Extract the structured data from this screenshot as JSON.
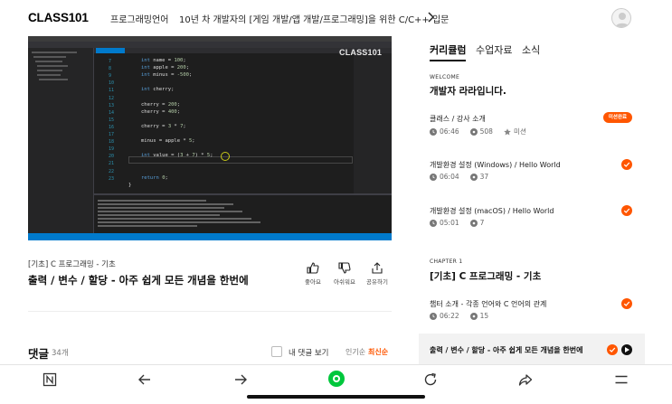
{
  "header": {
    "logo": "CLASS101",
    "breadcrumb_category": "프로그래밍언어",
    "breadcrumb_course": "10년 차 개발자의 [게임 개발/앱 개발/프로그래밍]을 위한 C/C++ 입문"
  },
  "video": {
    "watermark": "CLASS101",
    "line_numbers": [
      "7",
      "8",
      "9",
      "10",
      "11",
      "12",
      "13",
      "14",
      "15",
      "16",
      "17",
      "18",
      "19",
      "20",
      "21",
      "22",
      "23"
    ],
    "code_lines": [
      "int name = 100;",
      "int apple = 200;",
      "int minus = -500;",
      "int cherry;",
      "cherry = 200;",
      "cherry = 400;",
      "cherry = 3 * 7;",
      "minus = apple * 5;",
      "int value = (3 + 7) * 5;",
      "return 0;",
      "}"
    ]
  },
  "lecture": {
    "category": "[기초] C 프로그래밍 - 기초",
    "title": "출력 / 변수 / 할당 - 아주 쉽게 모든 개념을 한번에",
    "actions": {
      "like": "좋아요",
      "dislike": "아쉬워요",
      "share": "공유하기"
    }
  },
  "comments": {
    "title": "댓글",
    "count": "34개",
    "my_comments": "내 댓글 보기",
    "sort_popular": "인기순",
    "sort_latest": "최신순"
  },
  "sidebar": {
    "tabs": [
      "커리큘럼",
      "수업자료",
      "소식"
    ],
    "welcome_label": "WELCOME",
    "welcome_title": "개발자 라라입니다.",
    "items": [
      {
        "title": "클래스 / 강사 소개",
        "duration": "06:46",
        "views": "508",
        "status": "미션",
        "badge": "미션완료"
      },
      {
        "title": "개발환경 설정 (Windows) / Hello World",
        "duration": "06:04",
        "views": "37"
      },
      {
        "title": "개발환경 설정 (macOS) / Hello World",
        "duration": "05:01",
        "views": "7"
      }
    ],
    "chapter_label": "CHAPTER 1",
    "chapter_title": "[기초] C 프로그래밍 - 기초",
    "chapter_items": [
      {
        "title": "챕터 소개 - 각종 언어와 C 언어의 관계",
        "duration": "06:22",
        "views": "15"
      },
      {
        "title": "출력 / 변수 / 할당 - 아주 쉽게 모든 개념을 한번에"
      }
    ]
  },
  "colors": {
    "accent": "#ff5600",
    "nav_green": "#00c73c",
    "ide_blue": "#007acc"
  }
}
